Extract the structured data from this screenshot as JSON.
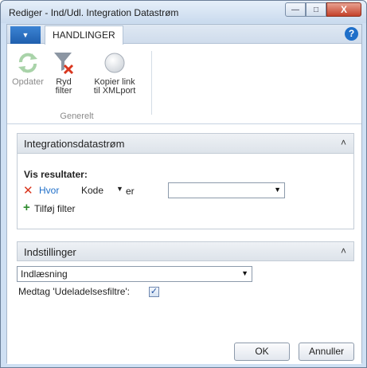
{
  "window": {
    "title": "Rediger - Ind/Udl. Integration Datastrøm",
    "minimize_glyph": "—",
    "maximize_glyph": "□",
    "close_glyph": "X"
  },
  "ribbon": {
    "file_tab_glyph": "▼",
    "active_tab": "HANDLINGER",
    "help_glyph": "?",
    "buttons": {
      "refresh": "Opdater",
      "clear_filter_1": "Ryd",
      "clear_filter_2": "filter",
      "copy_link_1": "Kopier link",
      "copy_link_2": "til XMLport"
    },
    "group_label": "Generelt"
  },
  "filter_section": {
    "title": "Integrationsdatastrøm",
    "show_results": "Vis resultater:",
    "where_label": "Hvor",
    "field_value": "Kode",
    "operator": "er",
    "filter_value": "",
    "add_filter": "Tilføj filter"
  },
  "settings_section": {
    "title": "Indstillinger",
    "mode_value": "Indlæsning",
    "include_exclusion_label": "Medtag 'Udeladelsesfiltre':",
    "include_exclusion_checked": true,
    "check_glyph": "✓"
  },
  "footer": {
    "ok_label": "OK",
    "cancel_label": "Annuller"
  },
  "chevron_glyph": "˄",
  "colors": {
    "accent_blue": "#1f6fc9",
    "remove_red": "#d9361e",
    "add_green": "#2e8b2e"
  }
}
